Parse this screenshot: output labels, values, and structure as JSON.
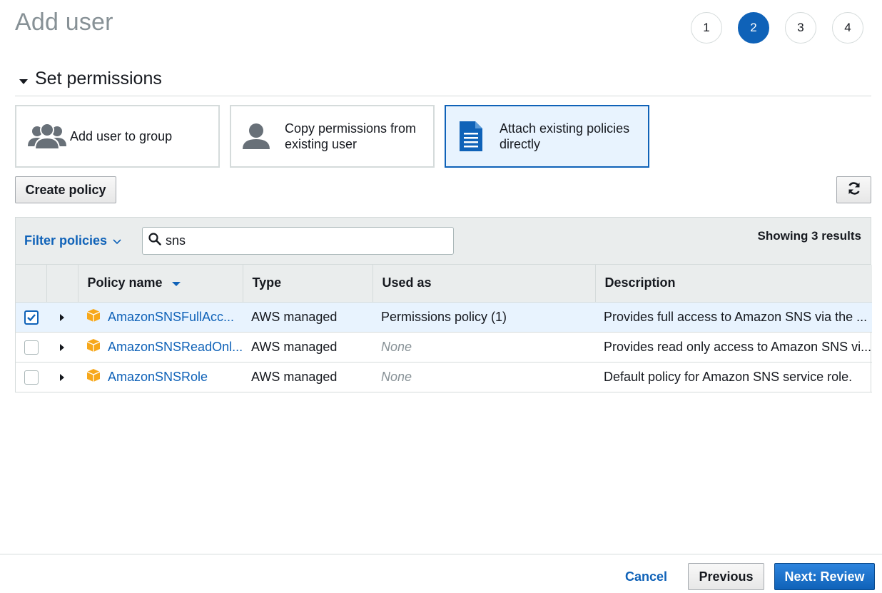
{
  "header": {
    "title": "Add user"
  },
  "steps": [
    {
      "label": "1",
      "active": false
    },
    {
      "label": "2",
      "active": true
    },
    {
      "label": "3",
      "active": false
    },
    {
      "label": "4",
      "active": false
    }
  ],
  "section": {
    "title": "Set permissions"
  },
  "tiles": [
    {
      "label": "Add user to group",
      "icon": "users-group-icon",
      "selected": false
    },
    {
      "label": "Copy permissions from existing user",
      "icon": "user-icon",
      "selected": false
    },
    {
      "label": "Attach existing policies directly",
      "icon": "document-icon",
      "selected": true
    }
  ],
  "toolbar": {
    "create_label": "Create policy",
    "refresh_icon": "refresh-icon"
  },
  "filter": {
    "label": "Filter policies",
    "search_value": "sns",
    "results": "Showing 3 results"
  },
  "table": {
    "columns": [
      "Policy name",
      "Type",
      "Used as",
      "Description"
    ],
    "rows": [
      {
        "checked": true,
        "name": "AmazonSNSFullAcc...",
        "type": "AWS managed",
        "used_as": "Permissions policy (1)",
        "description": "Provides full access to Amazon SNS via the ..."
      },
      {
        "checked": false,
        "name": "AmazonSNSReadOnl...",
        "type": "AWS managed",
        "used_as": "None",
        "description": "Provides read only access to Amazon SNS vi..."
      },
      {
        "checked": false,
        "name": "AmazonSNSRole",
        "type": "AWS managed",
        "used_as": "None",
        "description": "Default policy for Amazon SNS service role."
      }
    ]
  },
  "footer": {
    "cancel": "Cancel",
    "previous": "Previous",
    "next": "Next: Review"
  },
  "colors": {
    "accent": "#0f62b8",
    "selected_bg": "#e8f3fe",
    "policy_icon": "#f7a81b"
  }
}
